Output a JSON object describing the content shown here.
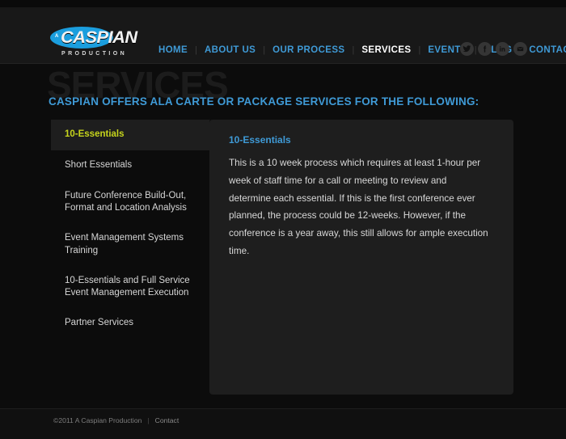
{
  "site": {
    "logo": {
      "prefix": "A",
      "word": "CASPIAN",
      "subtitle": "PRODUCTION"
    },
    "accent_blue": "#3f9ad6",
    "accent_yellow": "#c6d41c",
    "logo_blue": "#1b9ede"
  },
  "nav": {
    "items": [
      {
        "label": "HOME",
        "active": false
      },
      {
        "label": "ABOUT US",
        "active": false
      },
      {
        "label": "OUR PROCESS",
        "active": false
      },
      {
        "label": "SERVICES",
        "active": true
      },
      {
        "label": "EVENTS",
        "active": false
      },
      {
        "label": "BLOG",
        "active": false
      },
      {
        "label": "CONTACT",
        "active": false
      }
    ],
    "separator": "|"
  },
  "social": {
    "icons": [
      {
        "name": "twitter-icon",
        "title": "Twitter"
      },
      {
        "name": "facebook-icon",
        "title": "Facebook"
      },
      {
        "name": "linkedin-icon",
        "title": "LinkedIn"
      },
      {
        "name": "email-icon",
        "title": "Email"
      }
    ]
  },
  "page": {
    "watermark": "SERVICES",
    "subtitle": "CASPIAN OFFERS ALA CARTE OR PACKAGE SERVICES FOR THE FOLLOWING:"
  },
  "sidebar": {
    "items": [
      {
        "label": "10-Essentials",
        "active": true
      },
      {
        "label": "Short Essentials",
        "active": false
      },
      {
        "label": "Future Conference Build-Out, Format and Location Analysis",
        "active": false
      },
      {
        "label": "Event Management Systems Training",
        "active": false
      },
      {
        "label": "10-Essentials and Full Service Event Management Execution",
        "active": false
      },
      {
        "label": "Partner Services",
        "active": false
      }
    ]
  },
  "panel": {
    "title": "10-Essentials",
    "body": "This is a 10 week process which requires at least 1-hour per week of staff time for a call or meeting to review and determine each essential.  If this is the first conference ever planned, the process could be 12-weeks.  However, if the conference is a year away, this still allows for ample execution time."
  },
  "footer": {
    "copyright": "©2011 A Caspian Production",
    "separator": "|",
    "link": "Contact"
  }
}
